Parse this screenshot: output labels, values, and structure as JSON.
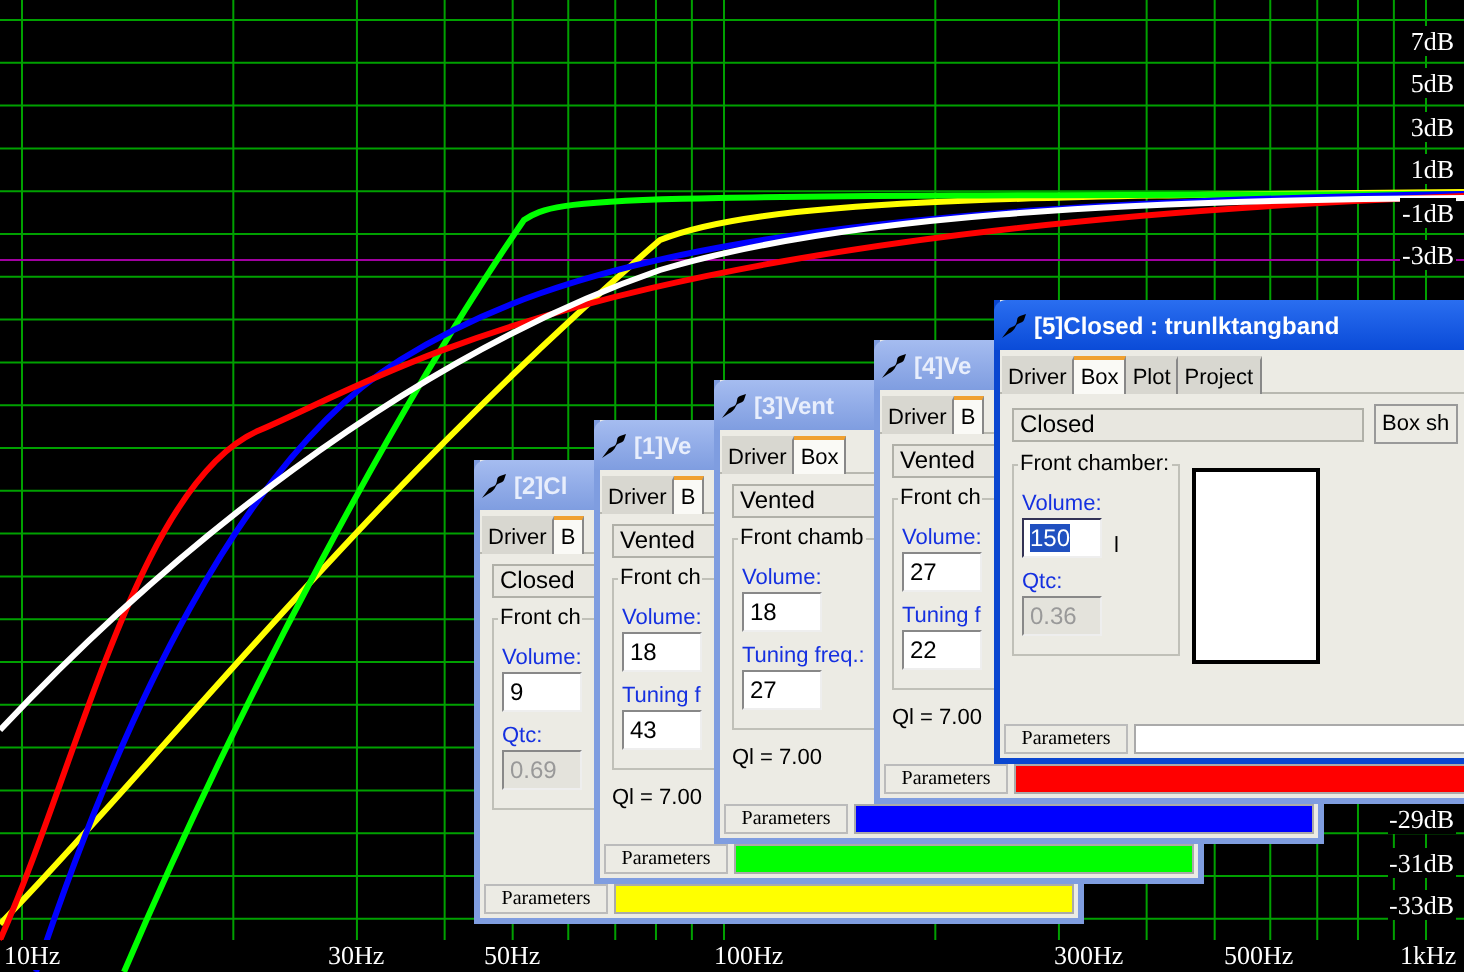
{
  "plot": {
    "y_labels": [
      "7dB",
      "5dB",
      "3dB",
      "1dB",
      "-1dB",
      "-3dB",
      "-29dB",
      "-31dB",
      "-33dB"
    ],
    "x_labels": [
      "10Hz",
      "30Hz",
      "50Hz",
      "100Hz",
      "300Hz",
      "500Hz",
      "1kHz"
    ]
  },
  "windows": [
    {
      "title": "[2]Cl",
      "active": false,
      "tabs": [
        {
          "label": "Driver",
          "selected": false
        },
        {
          "label": "B",
          "selected": true
        }
      ],
      "box_type": "Closed",
      "group_label": "Front ch",
      "fields": [
        {
          "label": "Volume:",
          "value": "9",
          "disabled": false
        },
        {
          "label": "Qtc:",
          "value": "0.69",
          "disabled": true
        }
      ],
      "status_bar": {
        "label": "Parameters",
        "color": "#ffff00"
      }
    },
    {
      "title": "[1]Ve",
      "active": false,
      "tabs": [
        {
          "label": "Driver",
          "selected": false
        },
        {
          "label": "B",
          "selected": true
        }
      ],
      "box_type": "Vented",
      "group_label": "Front ch",
      "fields": [
        {
          "label": "Volume:",
          "value": "18",
          "disabled": false
        },
        {
          "label": "Tuning f",
          "value": "43",
          "disabled": false
        }
      ],
      "ql": "Ql = 7.00",
      "status_bar": {
        "label": "Parameters",
        "color": "#00ff00"
      }
    },
    {
      "title": "[3]Vent",
      "active": false,
      "tabs": [
        {
          "label": "Driver",
          "selected": false
        },
        {
          "label": "Box",
          "selected": true
        }
      ],
      "box_type": "Vented",
      "group_label": "Front chamb",
      "fields": [
        {
          "label": "Volume:",
          "value": "18",
          "disabled": false
        },
        {
          "label": "Tuning freq.:",
          "value": "27",
          "disabled": false
        }
      ],
      "ql": "Ql = 7.00",
      "status_bar": {
        "label": "Parameters",
        "color": "#0000ff"
      }
    },
    {
      "title": "[4]Ve",
      "active": false,
      "tabs": [
        {
          "label": "Driver",
          "selected": false
        },
        {
          "label": "B",
          "selected": true
        }
      ],
      "box_type": "Vented",
      "group_label": "Front ch",
      "fields": [
        {
          "label": "Volume:",
          "value": "27",
          "disabled": false
        },
        {
          "label": "Tuning f",
          "value": "22",
          "disabled": false
        }
      ],
      "ql": "Ql = 7.00",
      "status_bar": {
        "label": "Parameters",
        "color": "#ff0000"
      }
    },
    {
      "title": "[5]Closed : trunlktangband",
      "active": true,
      "tabs": [
        {
          "label": "Driver",
          "selected": false
        },
        {
          "label": "Box",
          "selected": true
        },
        {
          "label": "Plot",
          "selected": false
        },
        {
          "label": "Project",
          "selected": false
        }
      ],
      "box_type": "Closed",
      "side_button": "Box sh",
      "group_label": "Front chamber:",
      "fields": [
        {
          "label": "Volume:",
          "value": "150",
          "unit": "l",
          "disabled": false,
          "selected": true
        },
        {
          "label": "Qtc:",
          "value": "0.36",
          "disabled": true,
          "selected": false
        }
      ],
      "preview": true,
      "status_bar": {
        "label": "Parameters",
        "color": "#ffffff"
      }
    }
  ]
}
